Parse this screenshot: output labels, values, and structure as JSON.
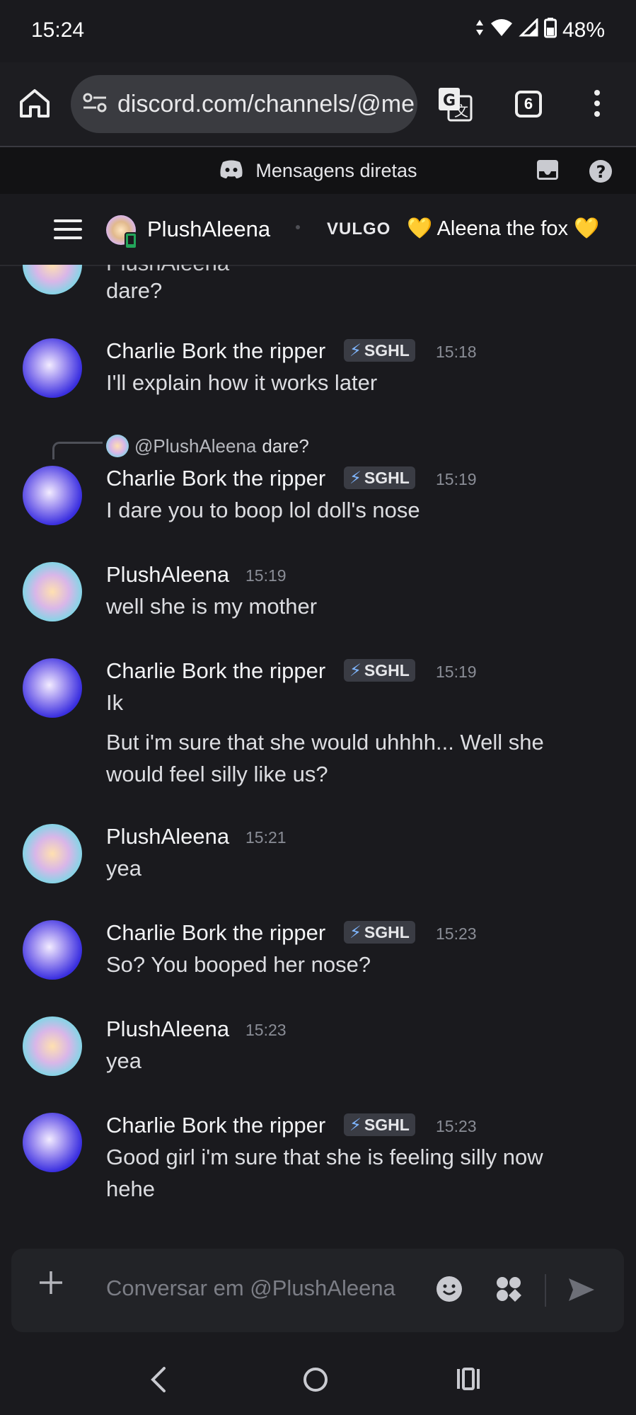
{
  "status_bar": {
    "time": "15:24",
    "battery_percent": "48%",
    "icons": [
      "data-arrows-icon",
      "wifi-icon",
      "signal-icon",
      "battery-icon"
    ]
  },
  "browser": {
    "url": "discord.com/channels/@me",
    "tab_count": "6",
    "icons": [
      "home-icon",
      "site-settings-icon",
      "translate-icon",
      "tabs-icon",
      "more-vert-icon"
    ]
  },
  "dm_header": {
    "title": "Mensagens diretas",
    "icons": [
      "discord-logo-icon",
      "inbox-icon",
      "help-icon"
    ]
  },
  "channel_header": {
    "name": "PlushAleena",
    "label": "VULGO",
    "nickname": "Aleena the fox",
    "nickname_emoji": "💛",
    "icons": [
      "hamburger-menu-icon",
      "mobile-status-icon"
    ]
  },
  "messages": [
    {
      "type": "cont",
      "author": "PlushAleena",
      "lines": [
        "dare?"
      ]
    },
    {
      "type": "full",
      "author": "Charlie Bork the ripper",
      "tag": "SGHL",
      "time": "15:18",
      "lines": [
        "I'll explain how it works later"
      ]
    },
    {
      "type": "reply",
      "author": "Charlie Bork the ripper",
      "tag": "SGHL",
      "time": "15:19",
      "reply_to": "@PlushAleena",
      "reply_text": "dare?",
      "lines": [
        "I dare you to boop lol doll's nose"
      ]
    },
    {
      "type": "full",
      "author": "PlushAleena",
      "time": "15:19",
      "lines": [
        "well she is my mother"
      ]
    },
    {
      "type": "full",
      "author": "Charlie Bork the ripper",
      "tag": "SGHL",
      "time": "15:19",
      "lines": [
        "Ik",
        "But i'm sure that she would uhhhh... Well she",
        "would feel silly like us?"
      ]
    },
    {
      "type": "full",
      "author": "PlushAleena",
      "time": "15:21",
      "lines": [
        "yea"
      ]
    },
    {
      "type": "full",
      "author": "Charlie Bork the ripper",
      "tag": "SGHL",
      "time": "15:23",
      "lines": [
        "So? You booped her nose?"
      ]
    },
    {
      "type": "full",
      "author": "PlushAleena",
      "time": "15:23",
      "lines": [
        "yea"
      ]
    },
    {
      "type": "full",
      "author": "Charlie Bork the ripper",
      "tag": "SGHL",
      "time": "15:23",
      "lines": [
        "Good girl i'm sure that she is feeling silly now",
        "hehe"
      ]
    }
  ],
  "composer": {
    "placeholder": "Conversar em @PlushAleena",
    "icons": [
      "plus-icon",
      "emoji-icon",
      "apps-icon",
      "send-icon"
    ]
  },
  "nav": {
    "icons": [
      "back-icon",
      "home-circle-icon",
      "recents-icon"
    ]
  },
  "colors": {
    "background": "#1a1a1e",
    "tag_bolt": "#7fb6ff",
    "timestamp": "#8a8d96"
  }
}
